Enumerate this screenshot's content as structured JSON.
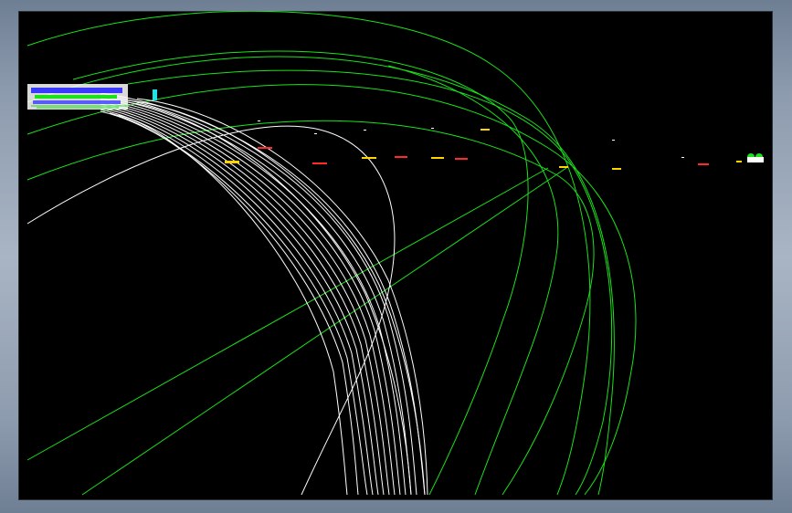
{
  "window": {
    "background_gradient": [
      "#6f7f93",
      "#a9b5c4"
    ]
  },
  "drawing": {
    "viewport_background": "#000000",
    "colors": {
      "alignment_curves": "#19e219",
      "road_outline": "#ffffff",
      "markers_yellow": "#ffd400",
      "markers_red": "#ff2a2a",
      "detail_blue": "#3a3aff",
      "detail_cyan": "#19e6e6"
    },
    "description_icons": [
      "cad-drawing-viewport",
      "road-curve-bundle",
      "alignment-arc-set",
      "station-marker-row",
      "cluster-detail-block"
    ]
  }
}
